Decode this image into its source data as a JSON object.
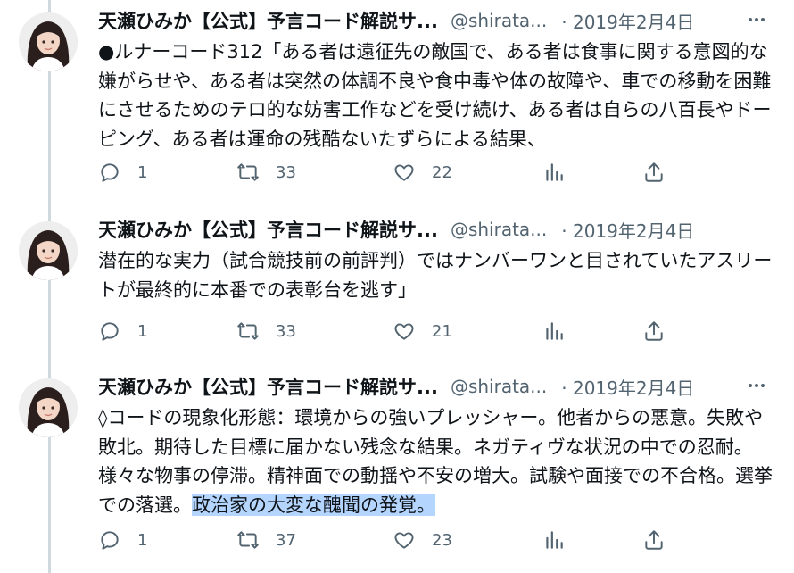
{
  "tweets": [
    {
      "name": "天瀬ひみか【公式】予言コード解説サ...",
      "handle": "@shirata...",
      "date": "· 2019年2月4日",
      "text": "●ルナーコード312「ある者は遠征先の敵国で、ある者は食事に関する意図的な嫌がらせや、ある者は突然の体調不良や食中毒や体の故障や、車での移動を困難にさせるためのテロ的な妨害工作などを受け続け、ある者は自らの八百長やドーピング、ある者は運命の残酷ないたずらによる結果、",
      "replies": "1",
      "retweets": "33",
      "likes": "22"
    },
    {
      "name": "天瀬ひみか【公式】予言コード解説サ...",
      "handle": "@shirata...",
      "date": "· 2019年2月4日",
      "text": "潜在的な実力（試合競技前の前評判）ではナンバーワンと目されていたアスリートが最終的に本番での表彰台を逃す」",
      "replies": "1",
      "retweets": "33",
      "likes": "21"
    },
    {
      "name": "天瀬ひみか【公式】予言コード解説サ...",
      "handle": "@shirata...",
      "date": "· 2019年2月4日",
      "text": "◊コードの現象化形態：環境からの強いプレッシャー。他者からの悪意。失敗や敗北。期待した目標に届かない残念な結果。ネガティヴな状況の中での忍耐。様々な物事の停滞。精神面での動揺や不安の増大。試験や面接での不合格。選挙での落選。",
      "text_highlight": "政治家の大変な醜聞の発覚。",
      "replies": "1",
      "retweets": "37",
      "likes": "23"
    }
  ],
  "icons": {
    "more": "more-icon",
    "reply": "reply-icon",
    "retweet": "retweet-icon",
    "like": "heart-icon",
    "views": "views-icon",
    "share": "share-icon"
  },
  "colors": {
    "text": "#0f1419",
    "secondary": "#536471",
    "thread_line": "#cfd9de",
    "highlight": "#b4d5fe"
  }
}
